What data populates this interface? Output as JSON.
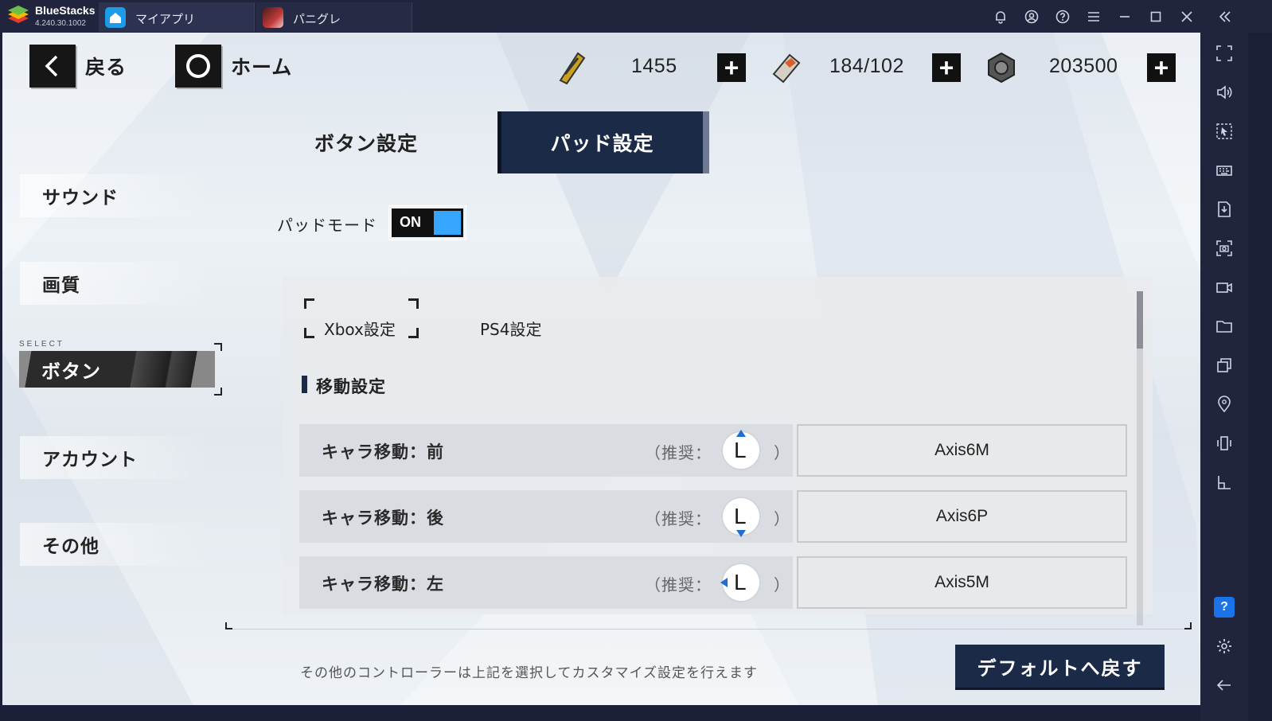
{
  "titlebar": {
    "app_name": "BlueStacks",
    "app_version": "4.240.30.1002",
    "tabs": [
      {
        "label": "マイアプリ",
        "icon": "home-icon"
      },
      {
        "label": "パニグレ",
        "icon": "game-icon"
      }
    ],
    "icons": [
      "bell-icon",
      "account-icon",
      "help-icon",
      "menu-icon",
      "minimize-icon",
      "maximize-icon",
      "close-icon"
    ],
    "collapse_icon": "double-chevron-left-icon"
  },
  "sidebar": {
    "icons": [
      "fullscreen-icon",
      "volume-icon",
      "cursor-icon",
      "keyboard-icon",
      "apk-icon",
      "screenshot-icon",
      "record-icon",
      "folder-icon",
      "multi-instance-icon",
      "location-icon",
      "shake-icon",
      "layout-icon"
    ],
    "help_label": "?",
    "bottom_icons": [
      "settings-icon",
      "back-icon"
    ]
  },
  "game": {
    "nav": {
      "back_label": "戻る",
      "home_label": "ホーム"
    },
    "resources": [
      {
        "icon": "ticket-icon",
        "value": "1455",
        "plus": "+"
      },
      {
        "icon": "battery-icon",
        "value": "184/102",
        "plus": "+"
      },
      {
        "icon": "coin-icon",
        "value": "203500",
        "plus": "+"
      }
    ],
    "tabs": {
      "button_settings": "ボタン設定",
      "pad_settings": "パッド設定"
    },
    "side_menu": {
      "sound": "サウンド",
      "quality": "画質",
      "select_tag": "SELECT",
      "button": "ボタン",
      "account": "アカウント",
      "other": "その他"
    },
    "pad_mode": {
      "label": "パッドモード",
      "toggle": "ON"
    },
    "subtabs": {
      "xbox": "Xbox設定",
      "ps4": "PS4設定"
    },
    "section_title": "移動設定",
    "rows": [
      {
        "name": "キャラ移動：前",
        "rec": "（推奨：",
        "stick": "L",
        "close": "）",
        "value": "Axis6M"
      },
      {
        "name": "キャラ移動：後",
        "rec": "（推奨：",
        "stick": "L",
        "close": "）",
        "value": "Axis6P"
      },
      {
        "name": "キャラ移動：左",
        "rec": "（推奨：",
        "stick": "L",
        "close": "）",
        "value": "Axis5M"
      }
    ],
    "hint": "その他のコントローラーは上記を選択してカスタマイズ設定を行えます",
    "default_button": "デフォルトへ戻す"
  },
  "colors": {
    "chrome": "#20243c",
    "accent_navy": "#1b2b47",
    "toggle_on": "#36a6ff",
    "stick_arrow": "#1f6fd1"
  }
}
